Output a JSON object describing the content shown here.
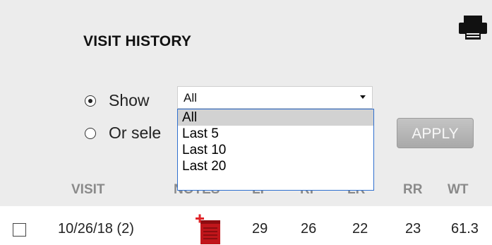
{
  "header": {
    "title": "VISIT HISTORY",
    "print_icon": "printer-icon"
  },
  "filter": {
    "show_label": "Show",
    "or_select_label": "Or sele",
    "selected_option": "All",
    "options": [
      "All",
      "Last 5",
      "Last 10",
      "Last 20"
    ],
    "apply_label": "APPLY"
  },
  "table": {
    "columns": [
      "VISIT",
      "NOTES",
      "LF",
      "RF",
      "LR",
      "RR",
      "WT"
    ],
    "rows": [
      {
        "visit": "10/26/18 (2)",
        "notes_icon": "add-note-icon",
        "lf": "29",
        "rf": "26",
        "lr": "22",
        "rr": "23",
        "wt": "61.3"
      }
    ]
  },
  "colors": {
    "panel_bg": "#ececec",
    "dropdown_border": "#2f6fcf",
    "apply_bg": "#b3b3b3",
    "notes_icon_red": "#c0161b"
  }
}
